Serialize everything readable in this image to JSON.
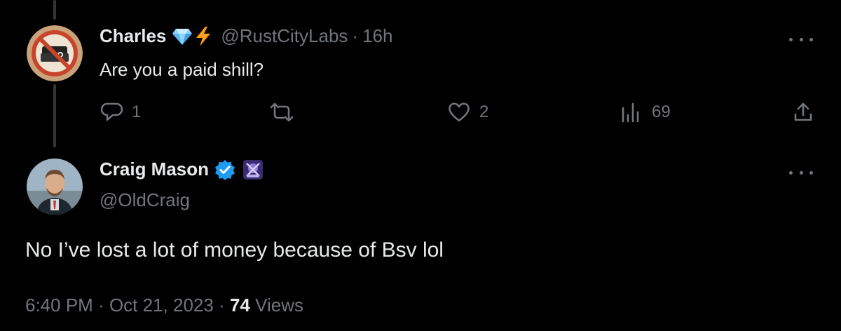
{
  "reply_tweet": {
    "display_name": "Charles",
    "badge_icons": [
      "diamond-icon",
      "lightning-icon"
    ],
    "handle": "@RustCityLabs",
    "time_ago": "16h",
    "text": "Are you a paid shill?",
    "actions": {
      "replies": "1",
      "retweets": "",
      "likes": "2",
      "views": "69"
    }
  },
  "main_tweet": {
    "display_name": "Craig Mason",
    "handle": "@OldCraig",
    "verified": true,
    "text": "No I’ve lost a lot of money because of Bsv lol",
    "time": "6:40 PM",
    "date": "Oct 21, 2023",
    "views_count": "74",
    "views_label": "Views"
  },
  "colors": {
    "background": "#000000",
    "primary_text": "#e7e9ea",
    "secondary_text": "#71767b",
    "verified_blue": "#1d9bf0",
    "thread_line": "#333639"
  }
}
